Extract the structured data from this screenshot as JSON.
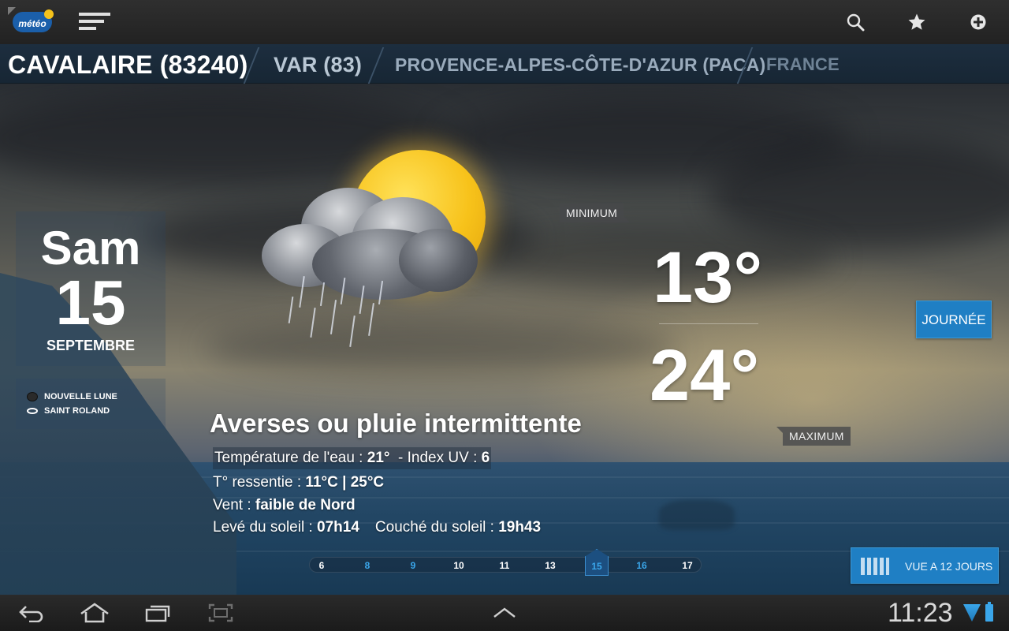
{
  "app": {
    "logo_text": "météo",
    "colors": {
      "accent": "#1f7fc4",
      "sun": "#f7c21a",
      "highlight": "#3aa6ea"
    }
  },
  "toolbar": {
    "menu_icon": "hamburger-menu-icon",
    "search_icon": "search-icon",
    "favorite_icon": "star-icon",
    "add_icon": "plus-circle-icon"
  },
  "breadcrumb": {
    "city": "CAVALAIRE (83240)",
    "department": "VAR (83)",
    "region": "PROVENCE-ALPES-CÔTE-D'AZUR (PACA)",
    "country": "FRANCE"
  },
  "date": {
    "day_name": "Sam",
    "day_number": "15",
    "month": "SEPTEMBRE"
  },
  "ephemeris": {
    "moon": "NOUVELLE LUNE",
    "saint": "SAINT ROLAND"
  },
  "temperature": {
    "min_label": "MINIMUM",
    "min_value": "13°",
    "max_label": "MAXIMUM",
    "max_value": "24°"
  },
  "day_button": "JOURNÉE",
  "condition": {
    "title": "Averses ou pluie intermittente",
    "water_temp_label": "Température de l'eau : ",
    "water_temp_value": "21°",
    "uv_label": "  - Index UV : ",
    "uv_value": "6",
    "feels_label": "T° ressentie : ",
    "feels_value": "11°C | 25°C",
    "wind_label": "Vent : ",
    "wind_value": "faible de Nord",
    "sunrise_label": "Levé du soleil : ",
    "sunrise_value": "07h14",
    "sunset_label": "Couché du soleil : ",
    "sunset_value": "19h43"
  },
  "timeline": {
    "hours": [
      "6",
      "8",
      "9",
      "10",
      "11",
      "13",
      "15",
      "16",
      "17"
    ],
    "selected": "15"
  },
  "forecast_button": "VUE A 12 JOURS",
  "system": {
    "back_icon": "back-icon",
    "home_icon": "home-icon",
    "recents_icon": "recent-apps-icon",
    "screenshot_icon": "screenshot-icon",
    "up_icon": "chevron-up-icon",
    "clock": "11:23"
  }
}
